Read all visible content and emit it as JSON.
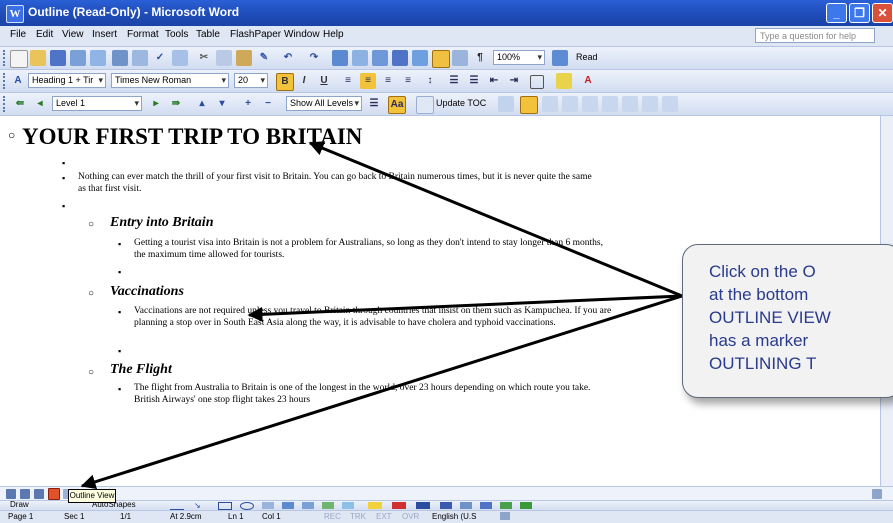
{
  "window": {
    "title": "Outline (Read-Only) - Microsoft Word",
    "app_icon": "W"
  },
  "menu": {
    "items": [
      "File",
      "Edit",
      "View",
      "Insert",
      "Format",
      "Tools",
      "Table",
      "FlashPaper",
      "Window",
      "Help"
    ],
    "help_placeholder": "Type a question for help"
  },
  "standard_toolbar": {
    "zoom": "100%",
    "read_label": "Read"
  },
  "formatting_toolbar": {
    "style": "Heading 1 + Tir",
    "font": "Times New Roman",
    "size": "20"
  },
  "outlining_toolbar": {
    "level": "Level 1",
    "show_levels": "Show All Levels",
    "update_toc": "Update TOC"
  },
  "document": {
    "heading": "YOUR FIRST TRIP TO BRITAIN",
    "intro": "Nothing can ever match the thrill of your first visit to Britain.  You can go back to Britain numerous times, but it is never quite the same as that first visit.",
    "sections": [
      {
        "title": "Entry into Britain",
        "text": "Getting a tourist visa into Britain is not a problem for Australians, so long as they don't intend to stay longer than 6 months, the maximum time allowed for tourists."
      },
      {
        "title": "Vaccinations",
        "text": "Vaccinations are not required unless you travel to Britain through countries that insist on them such as Kampuchea. If you are planning a stop over in South East Asia along the way, it is advisable to have cholera and typhoid vaccinations."
      },
      {
        "title": "The Flight",
        "text": "The flight from Australia to Britain is one of the longest in the world, over 23 hours depending on which route you take.  British Airways' one stop flight takes 23 hours"
      }
    ]
  },
  "tooltip": "Outline View",
  "drawing_toolbar": {
    "draw_label": "Draw",
    "autoshapes_label": "AutoShapes"
  },
  "statusbar": {
    "page": "Page  1",
    "sec": "Sec  1",
    "pages": "1/1",
    "at": "At  2.9cm",
    "ln": "Ln  1",
    "col": "Col  1",
    "rec": "REC",
    "trk": "TRK",
    "ext": "EXT",
    "ovr": "OVR",
    "language": "English (U.S"
  },
  "callout": {
    "text": "Click on the O\nat the bottom\nOUTLINE VIEW\nhas a marker\nOUTLINING T"
  },
  "colors": {
    "title_bar": "#1f4cb8",
    "callout_text": "#2a3a8c",
    "active_view_button": "#e0522a"
  }
}
